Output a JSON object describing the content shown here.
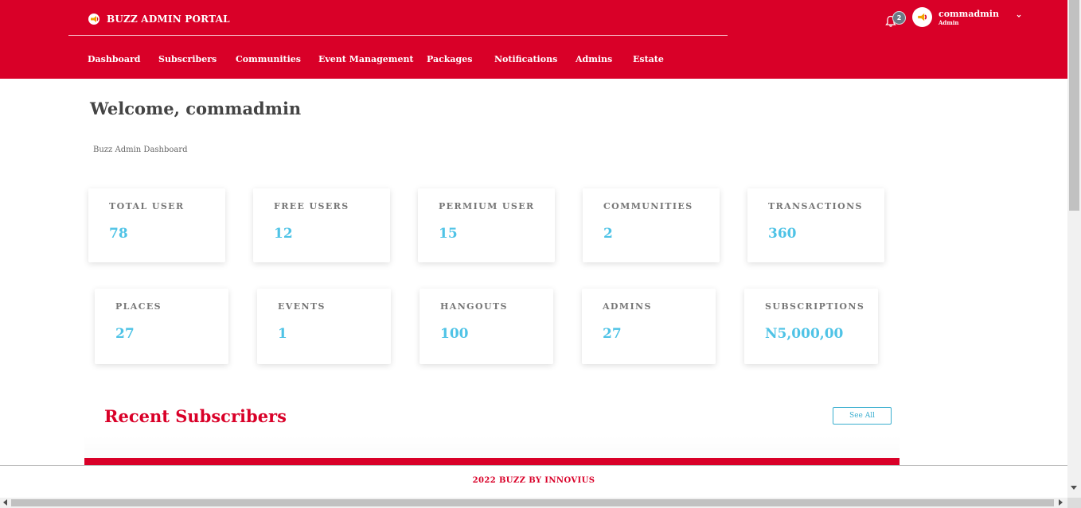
{
  "brand": {
    "title": "BUZZ ADMIN PORTAL",
    "logo_icon": "megaphone-icon"
  },
  "notifications": {
    "count": "2",
    "icon": "bell-icon"
  },
  "user": {
    "name": "commadmin",
    "role": "Admin",
    "avatar_icon": "megaphone-icon"
  },
  "nav": {
    "items": [
      {
        "label": "Dashboard"
      },
      {
        "label": "Subscribers"
      },
      {
        "label": "Communities"
      },
      {
        "label": "Event Management"
      },
      {
        "label": "Packages"
      },
      {
        "label": "Notifications"
      },
      {
        "label": "Admins"
      },
      {
        "label": "Estate"
      }
    ]
  },
  "main": {
    "welcome": "Welcome, commadmin",
    "subtitle": "Buzz Admin Dashboard"
  },
  "stats": {
    "row1": [
      {
        "label": "TOTAL USER",
        "value": "78"
      },
      {
        "label": "FREE USERS",
        "value": "12"
      },
      {
        "label": "PERMIUM USER",
        "value": "15"
      },
      {
        "label": "COMMUNITIES",
        "value": "2"
      },
      {
        "label": "TRANSACTIONS",
        "value": "360"
      }
    ],
    "row2": [
      {
        "label": "PLACES",
        "value": "27"
      },
      {
        "label": "EVENTS",
        "value": "1"
      },
      {
        "label": "HANGOUTS",
        "value": "100"
      },
      {
        "label": "ADMINS",
        "value": "27"
      },
      {
        "label": "SUBSCRIPTIONS",
        "value": "N5,000,00"
      }
    ]
  },
  "recent": {
    "title": "Recent Subscribers",
    "see_all": "See All"
  },
  "footer": {
    "text": "2022 BUZZ BY INNOVIUS"
  },
  "colors": {
    "brand": "#d90028",
    "accent": "#4fc3e6",
    "button": "#3aaecf"
  }
}
